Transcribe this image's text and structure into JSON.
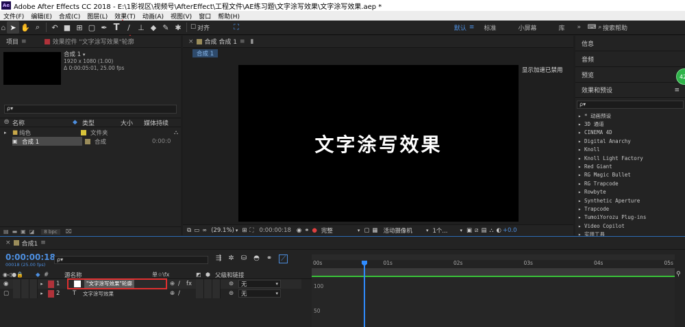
{
  "window": {
    "app_logo": "Ae",
    "title": "Adobe After Effects CC 2018 - E:\\1影视区\\视频号\\AfterEffect\\工程文件\\AE练习题\\文字涂写效果\\文字涂写效果.aep *"
  },
  "menu": [
    "文件(F)",
    "编辑(E)",
    "合成(C)",
    "图层(L)",
    "效果(T)",
    "动画(A)",
    "视图(V)",
    "窗口",
    "帮助(H)"
  ],
  "toolbar": {
    "align_label": "对齐",
    "workspaces": [
      "默认",
      "标准",
      "小屏幕",
      "库"
    ],
    "search_help_placeholder": "搜索帮助",
    "menu_more": "»"
  },
  "project": {
    "tab_label": "项目",
    "effects_tab_label": "效果控件 \"文字涂写效果\"轮廓",
    "comp_name": "合成 1",
    "comp_info1": "1920 x 1080 (1.00)",
    "comp_info2": "Δ 0:00:05:01, 25.00 fps",
    "columns": {
      "name": "名称",
      "type": "类型",
      "size": "大小",
      "duration": "媒体持续"
    },
    "items": [
      {
        "name": "纯色",
        "type": "文件夹",
        "duration": "",
        "color": "#d8c43a"
      },
      {
        "name": "合成 1",
        "type": "合成",
        "duration": "0:00:0",
        "color": "#9a8c5a"
      }
    ],
    "bpc": "8 bpc"
  },
  "viewer": {
    "tab_label": "合成 合成 1",
    "sub_tab": "合成 1",
    "gpu_notice": "显示加速已禁用",
    "canvas_text": "文字涂写效果",
    "zoom": "(29.1%)",
    "timecode": "0:00:00:18",
    "quality": "完整",
    "camera": "活动摄像机",
    "views": "1个...",
    "offset": "+0.0"
  },
  "right_panels": {
    "info": "信息",
    "audio": "音频",
    "preview": "预览",
    "effects_presets": "效果和预设",
    "search_placeholder": "ρ▾",
    "effects": [
      "▸ * 动画预设",
      "▸ 3D 通道",
      "▸ CINEMA 4D",
      "▸ Digital Anarchy",
      "▸ Knoll",
      "▸ Knoll Light Factory",
      "▸ Red Giant",
      "▸ RG Magic Bullet",
      "▸ RG Trapcode",
      "▸ Rowbyte",
      "▸ Synthetic Aperture",
      "▸ Trapcode",
      "▸ TumoiYorozu Plug-ins",
      "▸ Video Copilot",
      "▸ 实用工具"
    ]
  },
  "badge_text": "42",
  "timeline": {
    "tab_label": "合成1",
    "current_time": "0:00:00:18",
    "frame_info": "00018 (25.00 fps)",
    "search_placeholder": "ρ▾",
    "col_source": "源名称",
    "col_switches": "单☆\\fx",
    "col_parent": "父级和链接",
    "ruler": [
      "00s",
      "01s",
      "02s",
      "03s",
      "04s",
      "05s"
    ],
    "layers": [
      {
        "num": "1",
        "name": "\"文字涂写效果\"轮廓",
        "parent": "无",
        "color": "#b0323a"
      },
      {
        "num": "2",
        "name": "文字涂写效果",
        "parent": "无",
        "color": "#b0323a"
      }
    ],
    "graph_values": [
      "100",
      "50"
    ]
  },
  "colors": {
    "accent": "#2f6fb9",
    "play_head": "#2f8cff",
    "work_area_green": "#3ac43a",
    "highlight_red": "#e03030"
  }
}
